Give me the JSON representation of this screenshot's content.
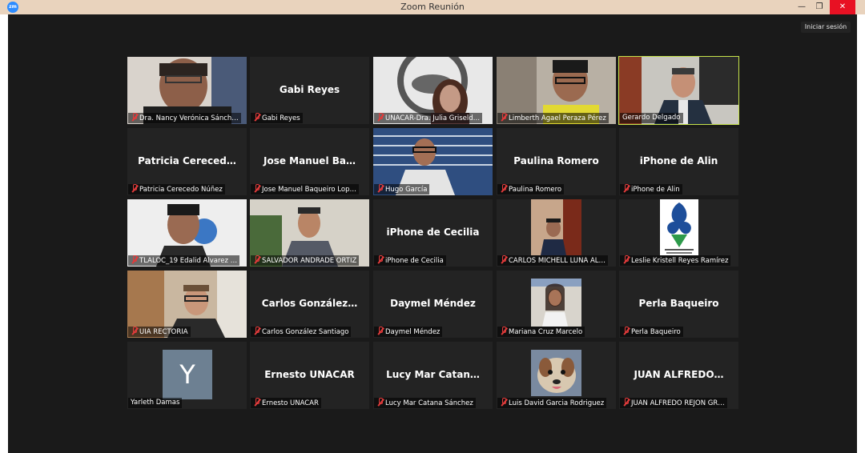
{
  "window": {
    "title": "Zoom Reunión",
    "app_icon": "zm",
    "minimize": "—",
    "restore": "❐",
    "close": "✕"
  },
  "toolbar": {
    "signin_label": "Iniciar sesión"
  },
  "colors": {
    "active_speaker": "#c6e34b",
    "muted_icon": "#e23b3b",
    "stage": "#1a1a1a",
    "tile": "#232323"
  },
  "participants": [
    {
      "name": "Dra. Nancy Verónica Sánch…",
      "display": "",
      "muted": true
    },
    {
      "name": "Gabi Reyes",
      "display": "Gabi Reyes",
      "muted": true
    },
    {
      "name": "UNACAR-Dra. Julia Griseld…",
      "display": "",
      "muted": true
    },
    {
      "name": "Limberth Agael Peraza Pérez",
      "display": "",
      "muted": true
    },
    {
      "name": "Gerardo Delgado",
      "display": "",
      "muted": false,
      "active": true
    },
    {
      "name": "Patricia Cerecedo Núñez",
      "display": "Patricia Cereced…",
      "muted": true
    },
    {
      "name": "Jose Manuel Baqueiro Lop…",
      "display": "Jose Manuel Ba…",
      "muted": true
    },
    {
      "name": "Hugo García",
      "display": "",
      "muted": true
    },
    {
      "name": "Paulina Romero",
      "display": "Paulina Romero",
      "muted": true
    },
    {
      "name": "iPhone de Alin",
      "display": "iPhone de Alin",
      "muted": true
    },
    {
      "name": "TLALOC_19 Edalid Alvarez …",
      "display": "",
      "muted": true
    },
    {
      "name": "SALVADOR ANDRADE ORTIZ",
      "display": "",
      "muted": true
    },
    {
      "name": "iPhone de Cecilia",
      "display": "iPhone de Cecilia",
      "muted": true
    },
    {
      "name": "CARLOS MICHELL LUNA AL…",
      "display": "",
      "muted": true
    },
    {
      "name": "Leslie Kristell Reyes Ramírez",
      "display": "",
      "muted": true
    },
    {
      "name": "UIA RECTORIA",
      "display": "",
      "muted": true
    },
    {
      "name": "Carlos González Santiago",
      "display": "Carlos González…",
      "muted": true
    },
    {
      "name": "Daymel Méndez",
      "display": "Daymel Méndez",
      "muted": true
    },
    {
      "name": "Mariana Cruz Marcelo",
      "display": "",
      "muted": true
    },
    {
      "name": "Perla Baqueiro",
      "display": "Perla Baqueiro",
      "muted": true
    },
    {
      "name": "Yarleth Damas",
      "display": "",
      "avatar_letter": "Y",
      "muted": false
    },
    {
      "name": "Ernesto UNACAR",
      "display": "Ernesto UNACAR",
      "muted": true
    },
    {
      "name": "Lucy Mar Catana Sánchez",
      "display": "Lucy Mar Catan…",
      "muted": true
    },
    {
      "name": "Luis David Garcia Rodriguez",
      "display": "",
      "muted": true
    },
    {
      "name": "JUAN ALFREDO REJON GR…",
      "display": "JUAN ALFREDO…",
      "muted": true
    }
  ]
}
